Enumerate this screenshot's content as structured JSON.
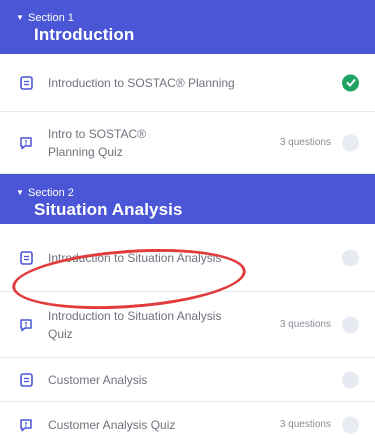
{
  "sections": [
    {
      "kicker": "Section 1",
      "title": "Introduction",
      "lessons": [
        {
          "label": "Introduction to SOSTAC® Planning",
          "meta": "",
          "type": "doc-icon",
          "status": "complete"
        },
        {
          "label": "Intro to SOSTAC® Planning Quiz",
          "meta": "3 questions",
          "type": "quiz-icon",
          "status": "incomplete"
        }
      ]
    },
    {
      "kicker": "Section 2",
      "title": "Situation Analysis",
      "lessons": [
        {
          "label": "Introduction to Situation Analysis",
          "meta": "",
          "type": "doc-icon",
          "status": "incomplete"
        },
        {
          "label": "Introduction to Situation Analysis Quiz",
          "meta": "3 questions",
          "type": "quiz-icon",
          "status": "incomplete"
        },
        {
          "label": "Customer Analysis",
          "meta": "",
          "type": "doc-icon",
          "status": "incomplete"
        },
        {
          "label": "Customer Analysis Quiz",
          "meta": "3 questions",
          "type": "quiz-icon",
          "status": "incomplete"
        }
      ]
    }
  ],
  "colors": {
    "section_bg": "#4a56d6",
    "complete": "#1fa463",
    "incomplete": "#e8eaf2",
    "annotation": "#e23b3b"
  }
}
